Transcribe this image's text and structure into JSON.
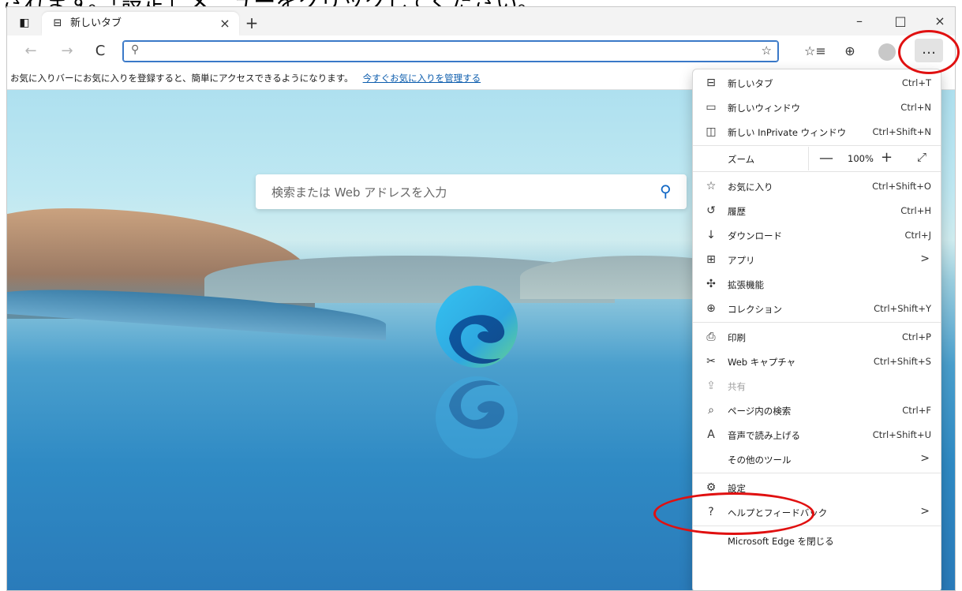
{
  "caption": "されます。「設定」メニューをクリックしてください。",
  "tab": {
    "title": "新しいタブ",
    "close": "×",
    "new": "+"
  },
  "window_controls": {
    "minimize": "–",
    "maximize": "□",
    "close": "×"
  },
  "toolbar": {
    "back": "←",
    "forward": "→",
    "refresh": "C",
    "address_value": "",
    "more": "…"
  },
  "favbar": {
    "text": "お気に入りバーにお気に入りを登録すると、簡単にアクセスできるようになります。",
    "link": "今すぐお気に入りを管理する"
  },
  "search": {
    "placeholder": "検索または Web アドレスを入力"
  },
  "menu": {
    "new_tab": {
      "label": "新しいタブ",
      "shortcut": "Ctrl+T"
    },
    "new_window": {
      "label": "新しいウィンドウ",
      "shortcut": "Ctrl+N"
    },
    "new_private": {
      "label": "新しい InPrivate ウィンドウ",
      "shortcut": "Ctrl+Shift+N"
    },
    "zoom": {
      "label": "ズーム",
      "minus": "—",
      "value": "100%",
      "plus": "+",
      "full": "⤢"
    },
    "favorites": {
      "label": "お気に入り",
      "shortcut": "Ctrl+Shift+O"
    },
    "history": {
      "label": "履歴",
      "shortcut": "Ctrl+H"
    },
    "downloads": {
      "label": "ダウンロード",
      "shortcut": "Ctrl+J"
    },
    "apps": {
      "label": "アプリ",
      "arrow": ">"
    },
    "extensions": {
      "label": "拡張機能"
    },
    "collections": {
      "label": "コレクション",
      "shortcut": "Ctrl+Shift+Y"
    },
    "print": {
      "label": "印刷",
      "shortcut": "Ctrl+P"
    },
    "web_capture": {
      "label": "Web キャプチャ",
      "shortcut": "Ctrl+Shift+S"
    },
    "share": {
      "label": "共有"
    },
    "find": {
      "label": "ページ内の検索",
      "shortcut": "Ctrl+F"
    },
    "read_aloud": {
      "label": "音声で読み上げる",
      "shortcut": "Ctrl+Shift+U"
    },
    "more_tools": {
      "label": "その他のツール",
      "arrow": ">"
    },
    "settings": {
      "label": "設定"
    },
    "help": {
      "label": "ヘルプとフィードバック",
      "arrow": ">"
    },
    "close_edge": {
      "label": "Microsoft Edge を閉じる"
    }
  },
  "colors": {
    "highlight": "#e01010",
    "accent": "#1167c4"
  }
}
